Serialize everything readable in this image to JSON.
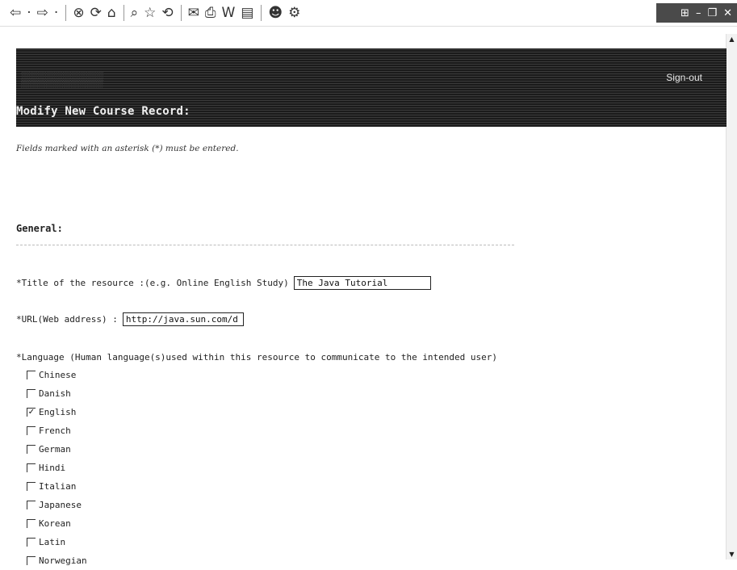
{
  "toolbar": {
    "buttons": [
      {
        "icon": "back-icon",
        "glyph": "⇦"
      },
      {
        "icon": "dropdown-icon",
        "glyph": "·"
      },
      {
        "icon": "forward-icon",
        "glyph": "⇨"
      },
      {
        "icon": "dropdown-icon",
        "glyph": "·"
      },
      {
        "icon": "stop-icon",
        "glyph": "⊗"
      },
      {
        "icon": "refresh-icon",
        "glyph": "⟳"
      },
      {
        "icon": "home-icon",
        "glyph": "⌂"
      },
      {
        "icon": "search-icon",
        "glyph": "⌕"
      },
      {
        "icon": "favorites-icon",
        "glyph": "☆"
      },
      {
        "icon": "history-icon",
        "glyph": "⟲"
      },
      {
        "icon": "mail-icon",
        "glyph": "✉"
      },
      {
        "icon": "print-icon",
        "glyph": "⎙"
      },
      {
        "icon": "edit-icon",
        "glyph": "W"
      },
      {
        "icon": "discuss-icon",
        "glyph": "▤"
      },
      {
        "icon": "messenger-icon",
        "glyph": "☻"
      },
      {
        "icon": "tools-icon",
        "glyph": "⚙"
      }
    ],
    "window_controls": {
      "menu": "⊞",
      "minimize": "–",
      "restore": "❐",
      "close": "✕"
    }
  },
  "banner": {
    "signout_label": "Sign-out"
  },
  "page": {
    "title": "Modify New Course Record:",
    "required_note": "Fields marked with an asterisk (*) must be entered."
  },
  "general": {
    "section_title": "General:",
    "title_field": {
      "label": "*Title of the resource :(e.g. Online English Study)",
      "value": "The Java Tutorial"
    },
    "url_field": {
      "label": "*URL(Web address) :",
      "value": "http://java.sun.com/d"
    },
    "language_label": "*Language (Human language(s)used within this resource to communicate to the intended user)",
    "languages": [
      {
        "name": "Chinese",
        "checked": false
      },
      {
        "name": "Danish",
        "checked": false
      },
      {
        "name": "English",
        "checked": true
      },
      {
        "name": "French",
        "checked": false
      },
      {
        "name": "German",
        "checked": false
      },
      {
        "name": "Hindi",
        "checked": false
      },
      {
        "name": "Italian",
        "checked": false
      },
      {
        "name": "Japanese",
        "checked": false
      },
      {
        "name": "Korean",
        "checked": false
      },
      {
        "name": "Latin",
        "checked": false
      },
      {
        "name": "Norwegian",
        "checked": false
      }
    ]
  },
  "colors": {
    "banner_bg": "#252525",
    "page_bg": "#ffffff",
    "text": "#222222"
  }
}
